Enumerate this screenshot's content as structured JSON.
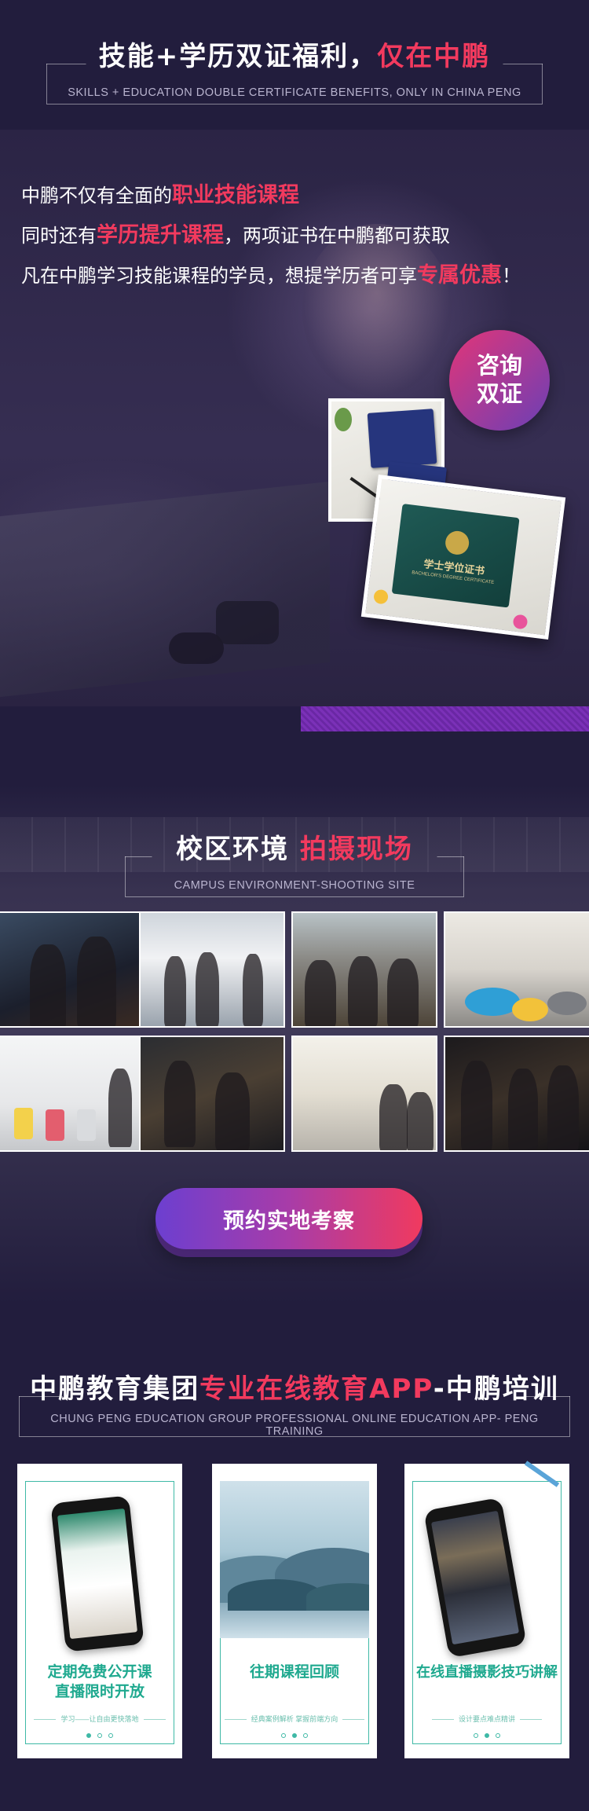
{
  "section_cert": {
    "title_main": "技能+学历双证福利，",
    "title_accent": "仅在中鹏",
    "subtitle": "SKILLS + EDUCATION DOUBLE CERTIFICATE BENEFITS, ONLY IN CHINA PENG",
    "intro": {
      "line1_pre": "中鹏不仅有全面的",
      "line1_hl": "职业技能课程",
      "line2_pre": "同时还有",
      "line2_hl": "学历提升课程",
      "line2_post": "，两项证书在中鹏都可获取",
      "line3_pre": "凡在中鹏学习技能课程的学员，想提学历者可享",
      "line3_hl": "专属优惠",
      "line3_post": "！"
    },
    "consult_line1": "咨询",
    "consult_line2": "双证",
    "cert_card_title": "学士学位证书",
    "cert_card_en": "BACHELOR'S DEGREE CERTIFICATE"
  },
  "section_campus": {
    "title_main": "校区环境 ",
    "title_accent": "拍摄现场",
    "subtitle": "CAMPUS ENVIRONMENT-SHOOTING SITE",
    "visit_button": "预约实地考察"
  },
  "section_app": {
    "title_main": "中鹏教育集团",
    "title_accent": "专业在线教育APP",
    "title_end": "-中鹏培训",
    "subtitle": "CHUNG PENG EDUCATION GROUP PROFESSIONAL ONLINE EDUCATION APP- PENG TRAINING",
    "cards": [
      {
        "caption_line1": "定期免费公开课",
        "caption_line2": "直播限时开放",
        "tag": "学习——让自由更快落地",
        "active_dot": 0
      },
      {
        "caption_line1": "往期课程回顾",
        "caption_line2": "",
        "tag": "经典案例解析 掌握前端方向",
        "active_dot": 1
      },
      {
        "caption_line1": "在线直播摄影技巧讲解",
        "caption_line2": "",
        "tag": "设计要点难点精讲",
        "active_dot": 1
      }
    ]
  },
  "colors": {
    "background": "#221d3d",
    "accent": "#f23a5e",
    "teal": "#1fa98f",
    "purple_bar": "#7b31b8"
  }
}
